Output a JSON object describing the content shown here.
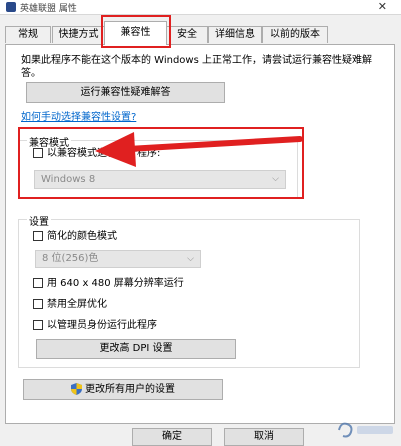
{
  "window": {
    "title": "英雄联盟 属性"
  },
  "tabs": [
    {
      "label": "常规"
    },
    {
      "label": "快捷方式"
    },
    {
      "label": "兼容性"
    },
    {
      "label": "安全"
    },
    {
      "label": "详细信息"
    },
    {
      "label": "以前的版本"
    }
  ],
  "description": "如果此程序不能在这个版本的 Windows 上正常工作，请尝试运行兼容性疑难解答。",
  "troubleshoot_button": "运行兼容性疑难解答",
  "manual_link": "如何手动选择兼容性设置?",
  "compat_mode": {
    "title": "兼容模式",
    "checkbox_label": "以兼容模式运行这个程序:",
    "os_select": "Windows 8"
  },
  "settings": {
    "title": "设置",
    "reduced_color": "简化的颜色模式",
    "color_select": "8 位(256)色",
    "low_res": "用 640 x 480 屏幕分辨率运行",
    "disable_fullscreen": "禁用全屏优化",
    "run_as_admin": "以管理员身份运行此程序",
    "dpi_button": "更改高 DPI 设置"
  },
  "all_users_button": "更改所有用户的设置",
  "footer": {
    "ok_button": "确定",
    "cancel_button": "取消"
  },
  "colors": {
    "annotation": "#e02020",
    "link": "#0066cc"
  }
}
